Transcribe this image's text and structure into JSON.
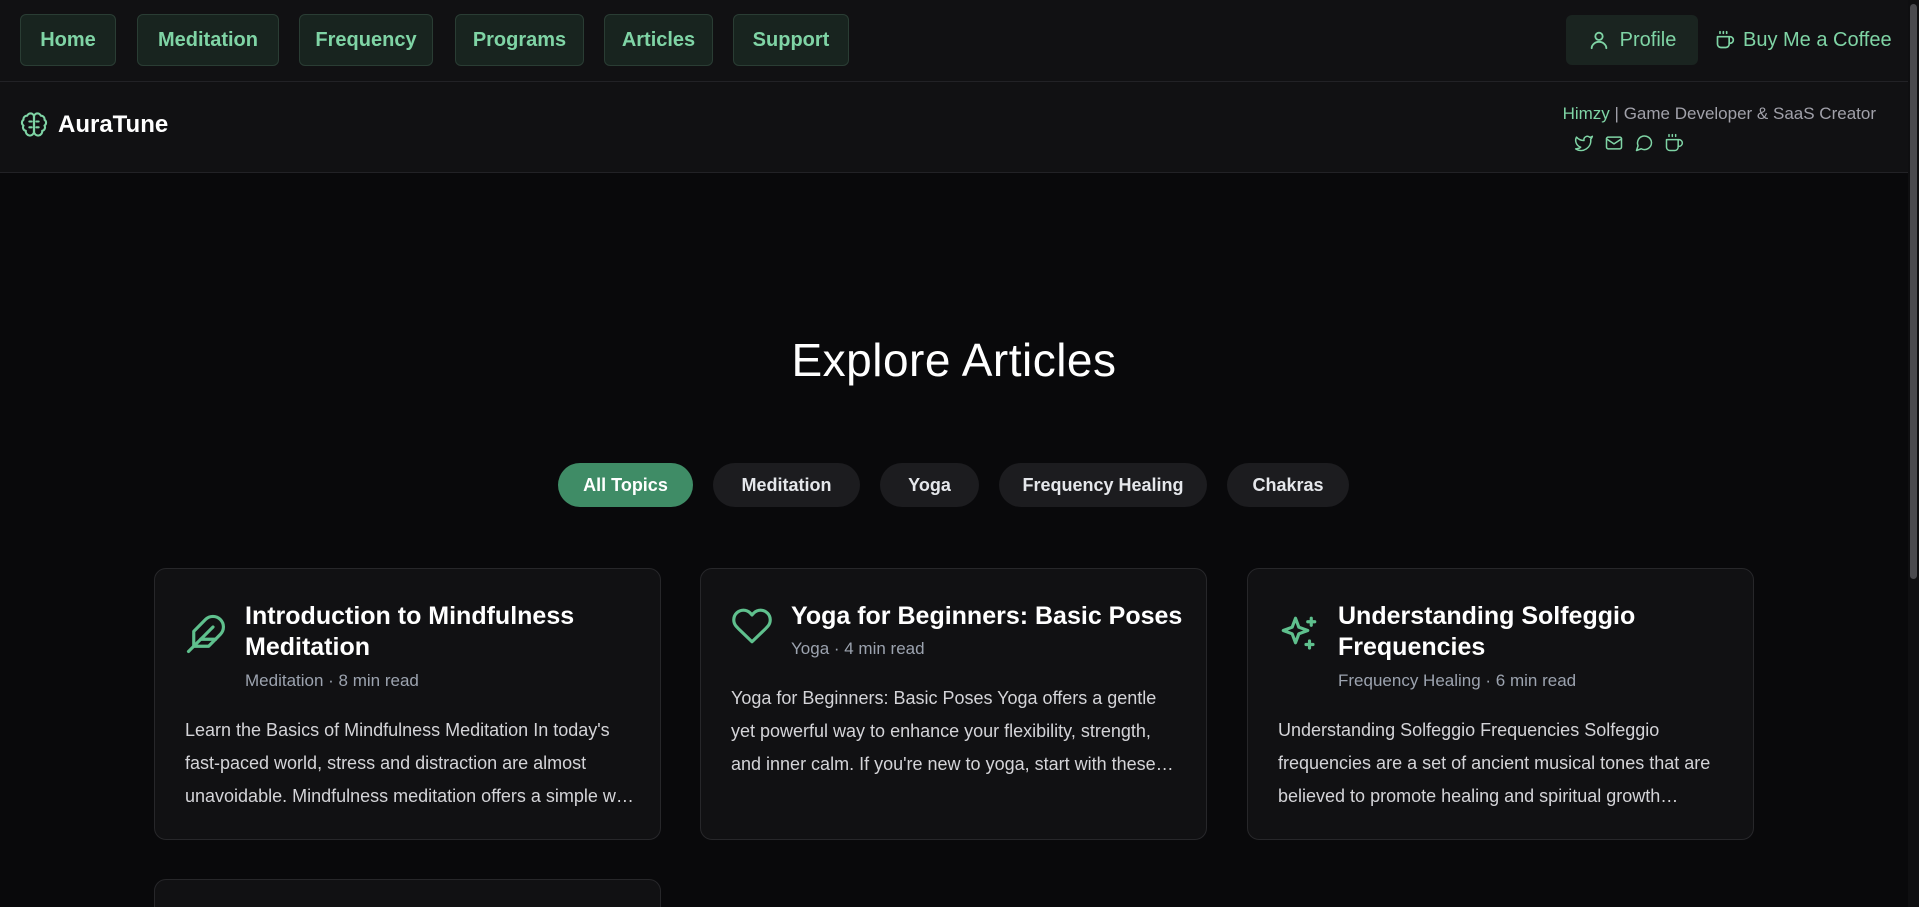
{
  "nav": {
    "items": [
      {
        "label": "Home"
      },
      {
        "label": "Meditation"
      },
      {
        "label": "Frequency"
      },
      {
        "label": "Programs"
      },
      {
        "label": "Articles"
      },
      {
        "label": "Support"
      }
    ],
    "profile_label": "Profile",
    "coffee_label": "Buy Me a Coffee"
  },
  "brand": {
    "name": "AuraTune",
    "author_name": "Himzy",
    "author_separator": "|",
    "author_role": "Game Developer & SaaS Creator",
    "social_icons": [
      "twitter-icon",
      "mail-icon",
      "chat-icon",
      "coffee-icon"
    ]
  },
  "main": {
    "title": "Explore Articles",
    "filters": [
      {
        "label": "All Topics",
        "active": true
      },
      {
        "label": "Meditation",
        "active": false
      },
      {
        "label": "Yoga",
        "active": false
      },
      {
        "label": "Frequency Healing",
        "active": false
      },
      {
        "label": "Chakras",
        "active": false
      }
    ],
    "articles": [
      {
        "icon": "feather-icon",
        "title": "Introduction to Mindfulness Meditation",
        "meta": "Meditation · 8 min read",
        "excerpt": "Learn the Basics of Mindfulness Meditation In today's fast-paced world, stress and distraction are almost unavoidable. Mindfulness meditation offers a simple way to find calm."
      },
      {
        "icon": "heart-icon",
        "title": "Yoga for Beginners: Basic Poses",
        "meta": "Yoga · 4 min read",
        "excerpt": "Yoga for Beginners: Basic Poses Yoga offers a gentle yet powerful way to enhance your flexibility, strength, and inner calm. If you're new to yoga, start with these poses."
      },
      {
        "icon": "sparkles-icon",
        "title": "Understanding Solfeggio Frequencies",
        "meta": "Frequency Healing · 6 min read",
        "excerpt": "Understanding Solfeggio Frequencies Solfeggio frequencies are a set of ancient musical tones that are believed to promote healing and spiritual growth throughout the body."
      }
    ]
  },
  "colors": {
    "accent": "#7fd4a5",
    "active_filter": "#3f8c66",
    "background": "#09090b",
    "card": "#111113"
  }
}
